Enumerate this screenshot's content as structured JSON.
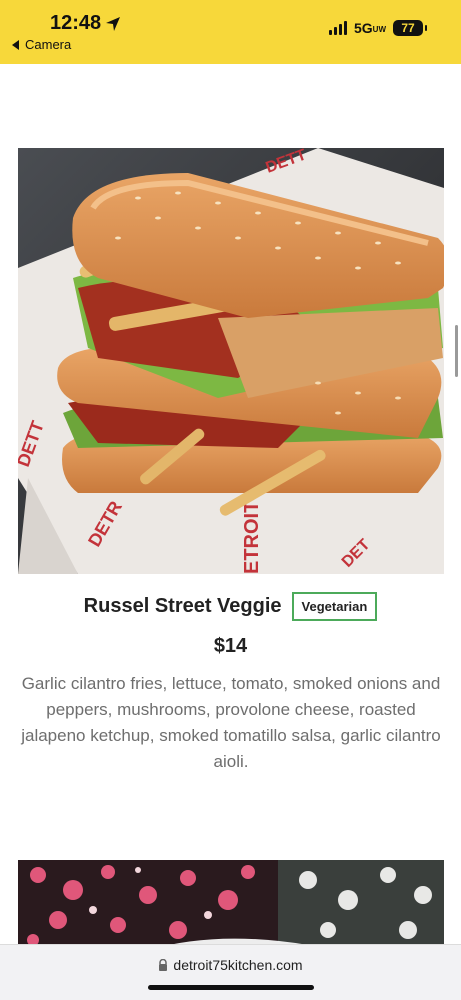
{
  "status_bar": {
    "time": "12:48",
    "back_label": "Camera",
    "network": "5G",
    "network_suffix": "UW",
    "battery": "77"
  },
  "menu_item": {
    "title": "Russel Street Veggie",
    "badge": "Vegetarian",
    "price": "$14",
    "description": "Garlic cilantro fries, lettuce, tomato, smoked onions and peppers, mushrooms, provolone cheese, roasted jalapeno ketchup, smoked tomatillo salsa, garlic cilantro aioli."
  },
  "browser": {
    "url": "detroit75kitchen.com"
  },
  "colors": {
    "status_bar_bg": "#f7d83a",
    "badge_border": "#4caa5a",
    "description_text": "#6e6e6e"
  },
  "icons": [
    "location-arrow-icon",
    "back-chevron-icon",
    "signal-icon",
    "battery-icon",
    "lock-icon"
  ]
}
